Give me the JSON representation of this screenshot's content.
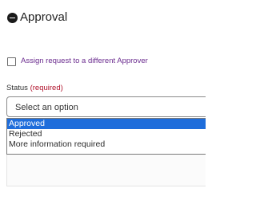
{
  "section": {
    "title": "Approval",
    "icon": "collapse-icon"
  },
  "assign_checkbox": {
    "label": "Assign request to a different Approver",
    "checked": false
  },
  "status": {
    "label": "Status",
    "required_text": "(required)",
    "placeholder": "Select an option",
    "options": [
      {
        "label": "Approved",
        "highlighted": true
      },
      {
        "label": "Rejected",
        "highlighted": false
      },
      {
        "label": "More information required",
        "highlighted": false
      }
    ]
  },
  "colors": {
    "highlight": "#1e6ddb",
    "link_purple": "#6a2b8e",
    "required_red": "#b0122b"
  }
}
